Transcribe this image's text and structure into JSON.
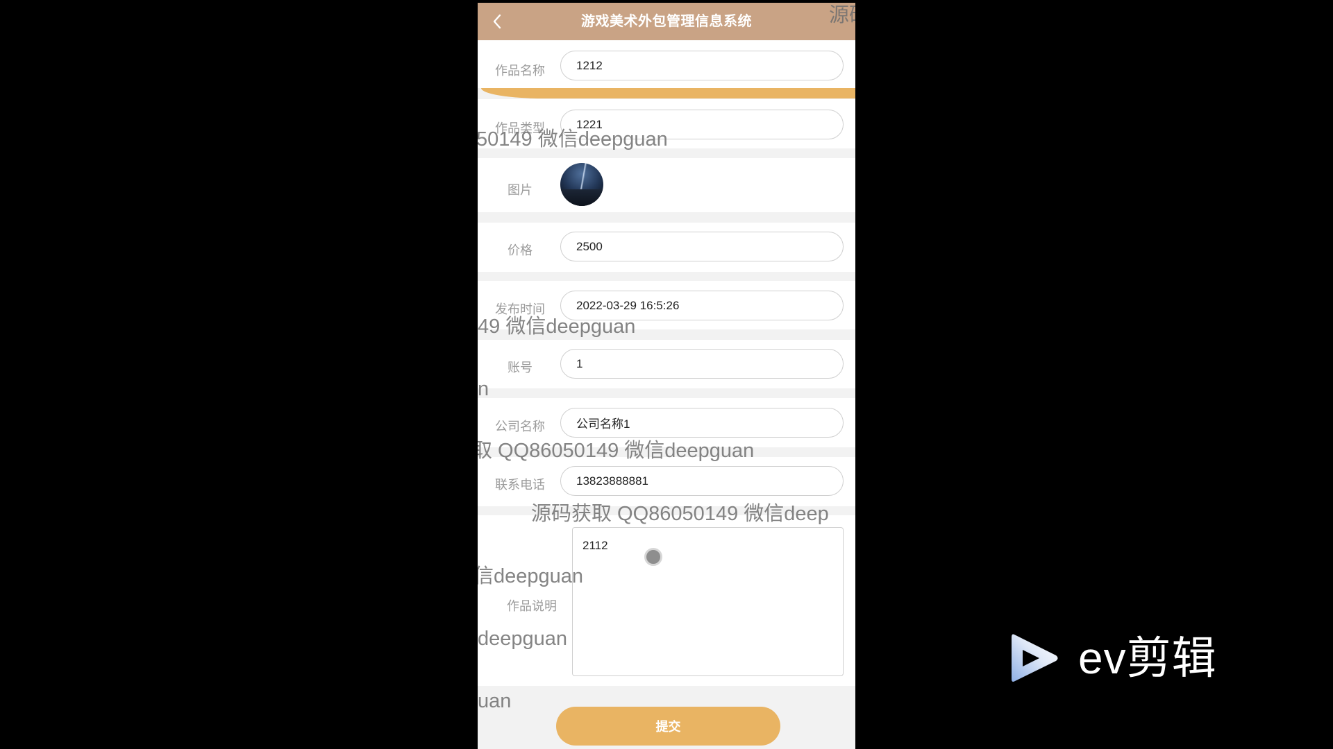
{
  "page": {
    "background": "#000000"
  },
  "header": {
    "title": "游戏美术外包管理信息系统",
    "back_icon": "chevron-left-icon",
    "color": "#c9a385"
  },
  "form": {
    "fields": [
      {
        "label": "作品名称",
        "value": "1212"
      },
      {
        "label": "作品类型",
        "value": "1221"
      },
      {
        "label": "图片",
        "image_icon": "image-thumbnail"
      },
      {
        "label": "价格",
        "value": "2500"
      },
      {
        "label": "发布时间",
        "value": "2022-03-29 16:5:26"
      },
      {
        "label": "账号",
        "value": "1"
      },
      {
        "label": "公司名称",
        "value": "公司名称1"
      },
      {
        "label": "联系电话",
        "value": "13823888881"
      },
      {
        "label": "作品说明",
        "value": "2112"
      }
    ],
    "submit_label": "提交",
    "accent_color": "#e9b463"
  },
  "watermarks": [
    "源码",
    "50149 微信deepguan",
    "49 微信deepguan",
    "n",
    "取 QQ86050149 微信deepguan",
    "源码获取 QQ86050149 微信deep",
    "信deepguan",
    "deepguan",
    "uan"
  ],
  "video_logo": {
    "text": "ev剪辑",
    "icon": "play-icon"
  }
}
